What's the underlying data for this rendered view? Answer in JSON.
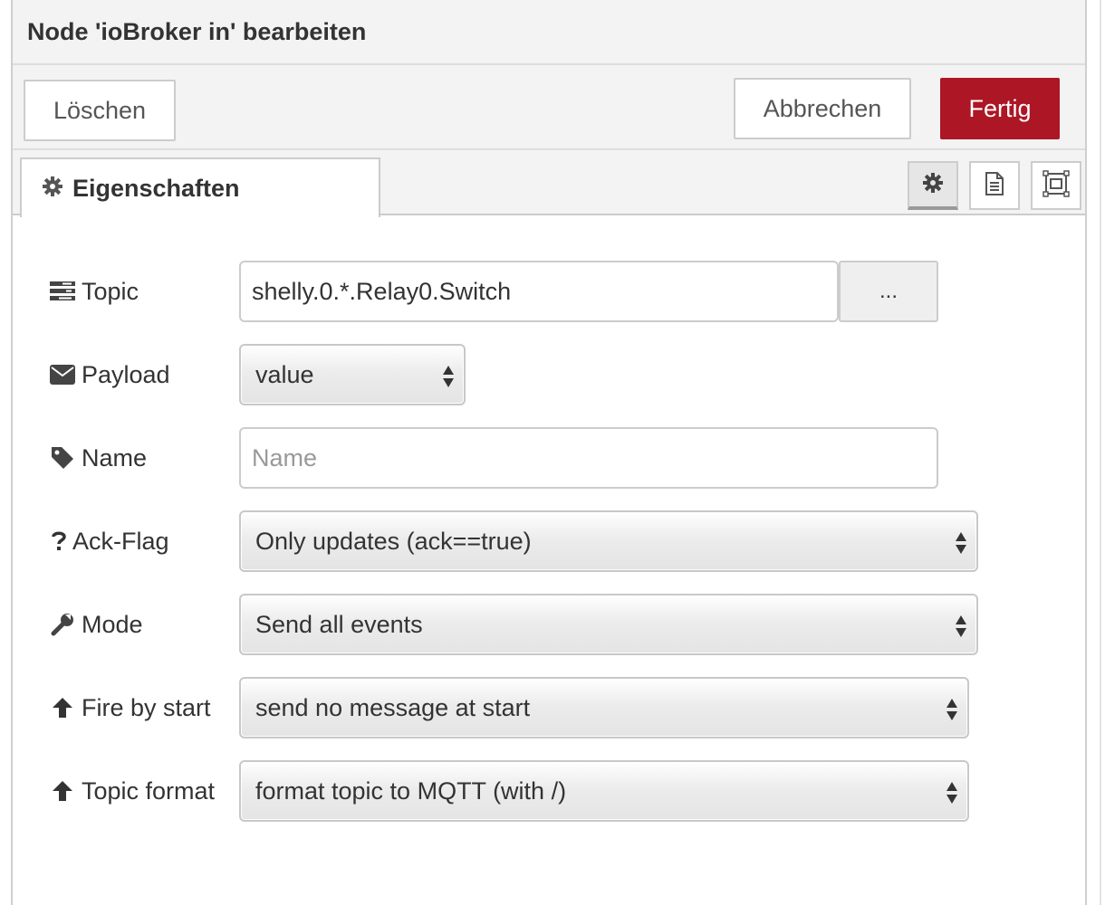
{
  "dialog": {
    "title": "Node 'ioBroker in' bearbeiten",
    "buttons": {
      "delete": "Löschen",
      "cancel": "Abbrechen",
      "done": "Fertig"
    },
    "accent_color": "#ad1625"
  },
  "tabs": {
    "properties": {
      "label": "Eigenschaften",
      "icon": "gear-icon"
    },
    "side_buttons": [
      {
        "icon": "gear-icon",
        "active": true
      },
      {
        "icon": "document-icon",
        "active": false
      },
      {
        "icon": "appearance-icon",
        "active": false
      }
    ]
  },
  "form": {
    "topic": {
      "label": "Topic",
      "icon": "tasks-icon",
      "value": "shelly.0.*.Relay0.Switch",
      "picker_label": "..."
    },
    "payload": {
      "label": "Payload",
      "icon": "envelope-icon",
      "value": "value"
    },
    "name": {
      "label": "Name",
      "icon": "tag-icon",
      "value": "",
      "placeholder": "Name"
    },
    "ack_flag": {
      "label": "Ack-Flag",
      "icon": "question-icon",
      "value": "Only updates (ack==true)"
    },
    "mode": {
      "label": "Mode",
      "icon": "wrench-icon",
      "value": "Send all events"
    },
    "fire_by_start": {
      "label": "Fire by start",
      "icon": "arrow-up-icon",
      "value": "send no message at start"
    },
    "topic_format": {
      "label": "Topic format",
      "icon": "arrow-up-icon",
      "value": "format topic to MQTT (with /)"
    }
  }
}
